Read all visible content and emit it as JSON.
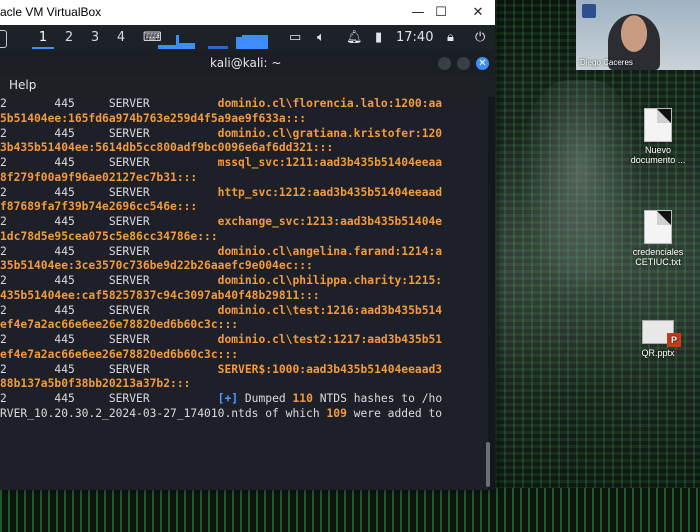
{
  "vbox": {
    "title": "acle VM VirtualBox",
    "min_glyph": "—",
    "max_glyph": "☐",
    "close_glyph": "✕"
  },
  "panel": {
    "workspaces": [
      "1",
      "2",
      "3",
      "4"
    ],
    "clock": "17:40",
    "icons": [
      "monitor-icon",
      "volume-icon",
      "bell-icon",
      "battery-icon",
      "lock-icon",
      "power-icon"
    ]
  },
  "terminal": {
    "title": "kali@kali: ~",
    "menu_help": "Help",
    "lines": [
      {
        "a": "2       445     SERVER          ",
        "b": "dominio.cl\\florencia.lalo:1200:aa"
      },
      {
        "a": "",
        "b": "5b51404ee:165fd6a974b763e259d4f5a9ae9f633a:::"
      },
      {
        "a": "2       445     SERVER          ",
        "b": "dominio.cl\\gratiana.kristofer:120"
      },
      {
        "a": "",
        "b": "3b435b51404ee:5614db5cc800adf9bc0096e6af6dd321:::"
      },
      {
        "a": "2       445     SERVER          ",
        "b": "mssql_svc:1211:aad3b435b51404eeaa"
      },
      {
        "a": "",
        "b": "8f279f00a9f96ae02127ec7b31:::"
      },
      {
        "a": "2       445     SERVER          ",
        "b": "http_svc:1212:aad3b435b51404eeaad"
      },
      {
        "a": "",
        "b": "f87689fa7f39b74e2696cc546e:::"
      },
      {
        "a": "2       445     SERVER          ",
        "b": "exchange_svc:1213:aad3b435b51404e"
      },
      {
        "a": "",
        "b": "1dc78d5e95cea075c5e86cc34786e:::"
      },
      {
        "a": "2       445     SERVER          ",
        "b": "dominio.cl\\angelina.farand:1214:a"
      },
      {
        "a": "",
        "b": "35b51404ee:3ce3570c736be9d22b26aaefc9e004ec:::"
      },
      {
        "a": "2       445     SERVER          ",
        "b": "dominio.cl\\philippa.charity:1215:"
      },
      {
        "a": "",
        "b": "435b51404ee:caf58257837c94c3097ab40f48b29811:::"
      },
      {
        "a": "2       445     SERVER          ",
        "b": "dominio.cl\\test:1216:aad3b435b514"
      },
      {
        "a": "",
        "b": "ef4e7a2ac66e6ee26e78820ed6b60c3c:::"
      },
      {
        "a": "2       445     SERVER          ",
        "b": "dominio.cl\\test2:1217:aad3b435b51"
      },
      {
        "a": "",
        "b": "ef4e7a2ac66e6ee26e78820ed6b60c3c:::"
      },
      {
        "a": "2       445     SERVER          ",
        "b": "SERVER$:1000:aad3b435b51404eeaad3"
      },
      {
        "a": "",
        "b": "88b137a5b0f38bb20213a37b2:::"
      }
    ],
    "dump_line1": {
      "prefix": "2       445     SERVER          ",
      "bracket": "[+]",
      "t1": " Dumped ",
      "n1": "110",
      "t2": " NTDS hashes to /ho"
    },
    "dump_line2": {
      "t1": "RVER_10.20.30.2_2024-03-27_174010.ntds of which ",
      "n1": "109",
      "t2": " were added to"
    }
  },
  "webcam": {
    "name": "Diego Caceres"
  },
  "desktop_icons": [
    {
      "label": "Nuevo documento ...",
      "icon": "text-document-icon"
    },
    {
      "label": "credenciales CETIUC.txt",
      "icon": "text-document-icon"
    },
    {
      "label": "QR.pptx",
      "icon": "powerpoint-file-icon"
    }
  ],
  "colors": {
    "accent": "#3f8cff",
    "terminal_bg": "#1e2029",
    "hash_orange": "#f39a3a"
  }
}
